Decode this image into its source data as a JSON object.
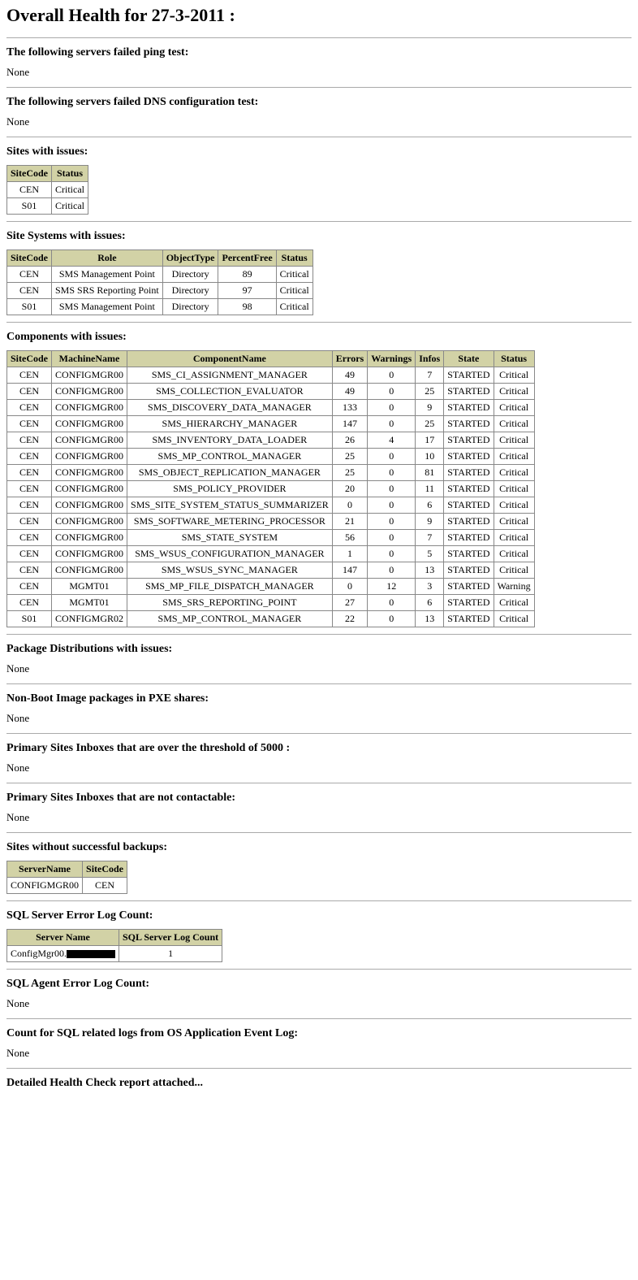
{
  "page_title": "Overall Health for 27-3-2011 :",
  "none_text": "None",
  "sections": {
    "ping": "The following servers failed ping test:",
    "dns": "The following servers failed DNS configuration test:",
    "sites_issues": "Sites with issues:",
    "site_systems": "Site Systems with issues:",
    "components": "Components with issues:",
    "pkg_dist": "Package Distributions with issues:",
    "non_boot": "Non-Boot Image packages in PXE shares:",
    "inbox_over": "Primary Sites Inboxes that are over the threshold of 5000 :",
    "inbox_nc": "Primary Sites Inboxes that are not contactable:",
    "no_backup": "Sites without successful backups:",
    "sql_err": "SQL Server Error Log Count:",
    "sql_agent": "SQL Agent Error Log Count:",
    "sql_os": "Count for SQL related logs from OS Application Event Log:",
    "detailed": "Detailed Health Check report attached..."
  },
  "sites_issues": {
    "headers": [
      "SiteCode",
      "Status"
    ],
    "rows": [
      [
        "CEN",
        "Critical"
      ],
      [
        "S01",
        "Critical"
      ]
    ]
  },
  "site_systems": {
    "headers": [
      "SiteCode",
      "Role",
      "ObjectType",
      "PercentFree",
      "Status"
    ],
    "rows": [
      [
        "CEN",
        "SMS Management Point",
        "Directory",
        "89",
        "Critical"
      ],
      [
        "CEN",
        "SMS SRS Reporting Point",
        "Directory",
        "97",
        "Critical"
      ],
      [
        "S01",
        "SMS Management Point",
        "Directory",
        "98",
        "Critical"
      ]
    ]
  },
  "components": {
    "headers": [
      "SiteCode",
      "MachineName",
      "ComponentName",
      "Errors",
      "Warnings",
      "Infos",
      "State",
      "Status"
    ],
    "rows": [
      [
        "CEN",
        "CONFIGMGR00",
        "SMS_CI_ASSIGNMENT_MANAGER",
        "49",
        "0",
        "7",
        "STARTED",
        "Critical"
      ],
      [
        "CEN",
        "CONFIGMGR00",
        "SMS_COLLECTION_EVALUATOR",
        "49",
        "0",
        "25",
        "STARTED",
        "Critical"
      ],
      [
        "CEN",
        "CONFIGMGR00",
        "SMS_DISCOVERY_DATA_MANAGER",
        "133",
        "0",
        "9",
        "STARTED",
        "Critical"
      ],
      [
        "CEN",
        "CONFIGMGR00",
        "SMS_HIERARCHY_MANAGER",
        "147",
        "0",
        "25",
        "STARTED",
        "Critical"
      ],
      [
        "CEN",
        "CONFIGMGR00",
        "SMS_INVENTORY_DATA_LOADER",
        "26",
        "4",
        "17",
        "STARTED",
        "Critical"
      ],
      [
        "CEN",
        "CONFIGMGR00",
        "SMS_MP_CONTROL_MANAGER",
        "25",
        "0",
        "10",
        "STARTED",
        "Critical"
      ],
      [
        "CEN",
        "CONFIGMGR00",
        "SMS_OBJECT_REPLICATION_MANAGER",
        "25",
        "0",
        "81",
        "STARTED",
        "Critical"
      ],
      [
        "CEN",
        "CONFIGMGR00",
        "SMS_POLICY_PROVIDER",
        "20",
        "0",
        "11",
        "STARTED",
        "Critical"
      ],
      [
        "CEN",
        "CONFIGMGR00",
        "SMS_SITE_SYSTEM_STATUS_SUMMARIZER",
        "0",
        "0",
        "6",
        "STARTED",
        "Critical"
      ],
      [
        "CEN",
        "CONFIGMGR00",
        "SMS_SOFTWARE_METERING_PROCESSOR",
        "21",
        "0",
        "9",
        "STARTED",
        "Critical"
      ],
      [
        "CEN",
        "CONFIGMGR00",
        "SMS_STATE_SYSTEM",
        "56",
        "0",
        "7",
        "STARTED",
        "Critical"
      ],
      [
        "CEN",
        "CONFIGMGR00",
        "SMS_WSUS_CONFIGURATION_MANAGER",
        "1",
        "0",
        "5",
        "STARTED",
        "Critical"
      ],
      [
        "CEN",
        "CONFIGMGR00",
        "SMS_WSUS_SYNC_MANAGER",
        "147",
        "0",
        "13",
        "STARTED",
        "Critical"
      ],
      [
        "CEN",
        "MGMT01",
        "SMS_MP_FILE_DISPATCH_MANAGER",
        "0",
        "12",
        "3",
        "STARTED",
        "Warning"
      ],
      [
        "CEN",
        "MGMT01",
        "SMS_SRS_REPORTING_POINT",
        "27",
        "0",
        "6",
        "STARTED",
        "Critical"
      ],
      [
        "S01",
        "CONFIGMGR02",
        "SMS_MP_CONTROL_MANAGER",
        "22",
        "0",
        "13",
        "STARTED",
        "Critical"
      ]
    ]
  },
  "no_backup": {
    "headers": [
      "ServerName",
      "SiteCode"
    ],
    "rows": [
      [
        "CONFIGMGR00",
        "CEN"
      ]
    ]
  },
  "sql_err": {
    "headers": [
      "Server Name",
      "SQL Server Log Count"
    ],
    "rows": [
      [
        "ConfigMgr00.",
        "1"
      ]
    ]
  }
}
